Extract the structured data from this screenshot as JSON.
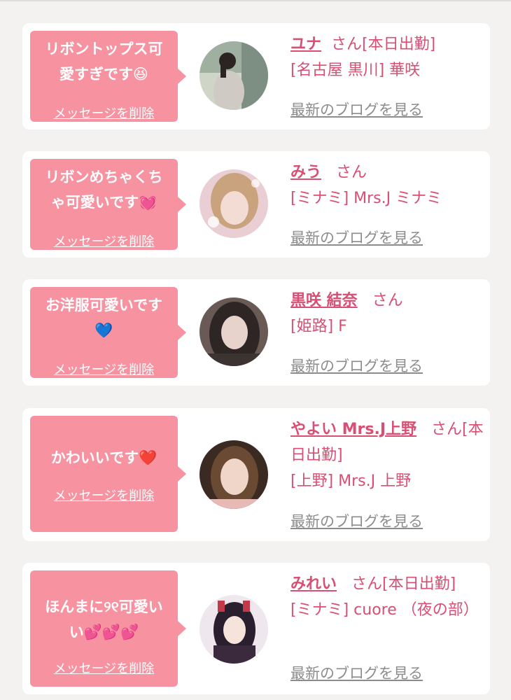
{
  "delete_label": "メッセージを削除",
  "blog_label": "最新のブログを見る",
  "entries": [
    {
      "message": "リボントップス可\n愛すぎです😆",
      "name": "ユナ",
      "suffix": "さん[本日出勤]",
      "shop": "[名古屋 黒川] 華咲"
    },
    {
      "message": "リボンめちゃくち\nゃ可愛いです💓",
      "name": "みう",
      "suffix": "さん",
      "shop": "[ミナミ] Mrs.J ミナミ"
    },
    {
      "message": "お洋服可愛いです\n💙",
      "name": "黒咲 結奈",
      "suffix": "さん",
      "shop": "[姫路] F"
    },
    {
      "message": "かわいいです❤️",
      "name": "やよい Mrs.J上野",
      "suffix": "さん[本日出勤]",
      "shop": "[上野] Mrs.J 上野"
    },
    {
      "message": "ほんまに୨୧可愛い\nい💕💕💕",
      "name": "みれい",
      "suffix": "さん[本日出勤]",
      "shop": "[ミナミ] cuore （夜の部）"
    }
  ]
}
